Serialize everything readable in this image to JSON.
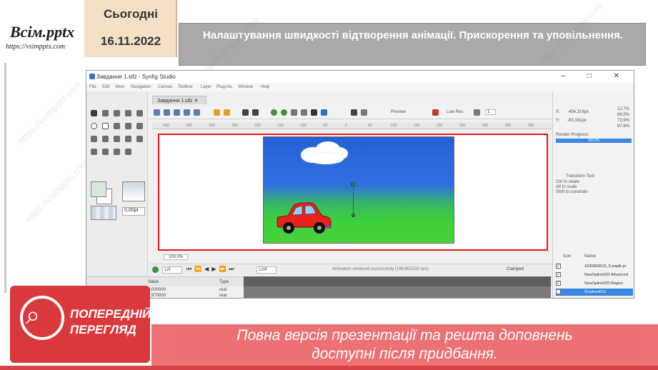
{
  "slide": {
    "logo_text": "Всім.pptx",
    "logo_url": "https://vsimpptx.com",
    "date_label": "Сьогодні",
    "date_value": "16.11.2022",
    "title": "Налаштування швидкості відтворення анімації.  Прискорення та уповільнення.",
    "watermark": "https://vsimpptx.com"
  },
  "window": {
    "title": "Завдання 1.sifz - Synfig Studio",
    "controls": [
      "–",
      "□",
      "✕"
    ],
    "menu": [
      "File",
      "Edit",
      "View",
      "Navigation",
      "Canvas",
      "Toolbox",
      "Layer",
      "Plug-Ins",
      "Window",
      "Help"
    ],
    "doc_tab": "Завдання 1.sifz",
    "preview_label": "Preview",
    "lowres_label": "Low Res",
    "quality_value": "1",
    "bline_width": "0,00pt",
    "ruler_marks": [
      "-400",
      "-350",
      "-300",
      "-250",
      "-200",
      "-150",
      "-100",
      "-50",
      "0",
      "50",
      "100",
      "150",
      "200",
      "250",
      "300",
      "350",
      "400"
    ],
    "zoom_value": "100,0%",
    "current_frame": "12f",
    "end_frame": "120f",
    "status_message": "Animation rendered successfully (199,852533 sec)",
    "clamped_label": "Clamped"
  },
  "params": {
    "header_value": "Value",
    "header_type": "Type",
    "rows": [
      {
        "value": "0,000000",
        "type": "real"
      },
      {
        "value": "0,970000",
        "type": "real"
      }
    ]
  },
  "info_panel": {
    "x_label": "X:",
    "x_value": "-454,316px",
    "y_label": "Y:",
    "y_value": "-83,161px",
    "r_value": "12,7%",
    "g_value": "88,5%",
    "b_value": "72,9%",
    "a_value": "67,6%",
    "render_progress_label": "Render Progress:",
    "render_progress": "100,0%",
    "tool_name": "Transform Tool",
    "tool_hint1": "Ctrl to rotate",
    "tool_hint2": "Alt to scale",
    "tool_hint3": "Shift to constrain"
  },
  "layers_panel": {
    "col_icon": "Icon",
    "col_name": "Name",
    "rows": [
      {
        "name": "1630663513_5-papik-pr",
        "checked": true,
        "selected": false
      },
      {
        "name": "NewSpline020 Advanced",
        "checked": true,
        "selected": false
      },
      {
        "name": "NewSpline020 Region",
        "checked": true,
        "selected": false
      },
      {
        "name": "Gradient015",
        "checked": true,
        "selected": true
      }
    ]
  },
  "overlay": {
    "badge_line1": "ПОПЕРЕДНІЙ",
    "badge_line2": "ПЕРЕГЛЯД",
    "banner_line1": "Повна версія презентації та решта доповнень",
    "banner_line2": "доступні після придбання.",
    "badge_color": "#d9393d",
    "banner_color": "#ec6a6d"
  },
  "colors": {
    "accent_red": "#e8141b",
    "sky": "#2262d6",
    "grass": "#3dcf3a",
    "car_body": "#e8231b"
  }
}
